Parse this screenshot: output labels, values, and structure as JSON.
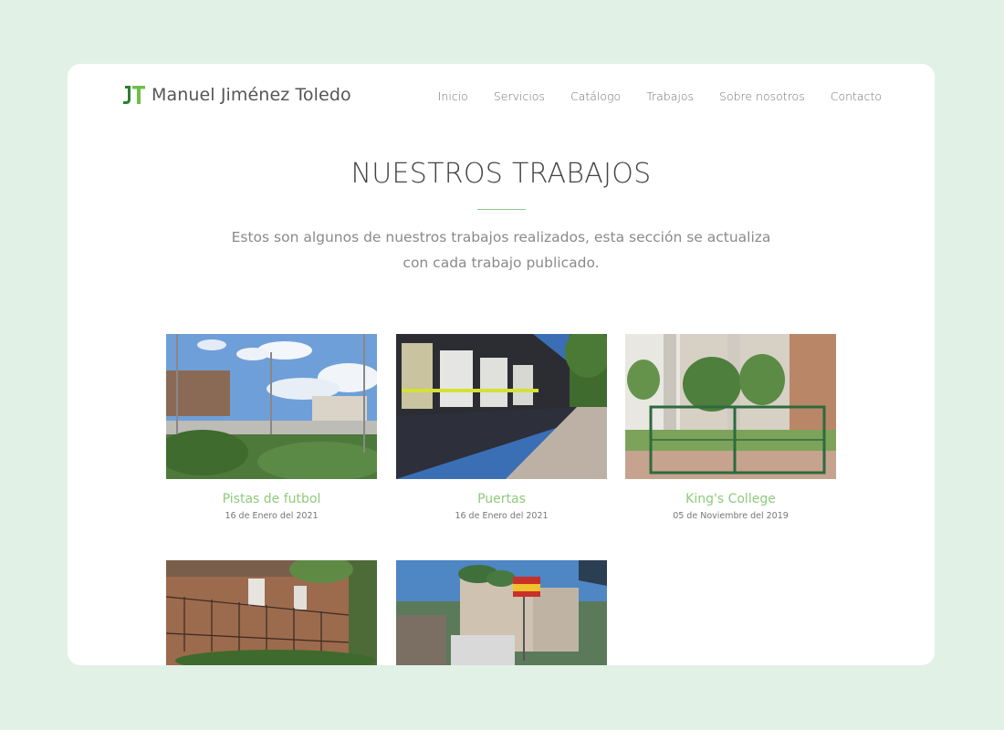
{
  "brand": {
    "name": "Manuel Jiménez Toledo",
    "logo_icon": "jt-logo-icon",
    "colors": {
      "accent": "#8fcb7b",
      "logo_dark": "#2e7d32",
      "logo_light": "#6cc04a"
    }
  },
  "nav": {
    "items": [
      {
        "label": "Inicio"
      },
      {
        "label": "Servicios"
      },
      {
        "label": "Catálogo"
      },
      {
        "label": "Trabajos"
      },
      {
        "label": "Sobre nosotros"
      },
      {
        "label": "Contacto"
      }
    ]
  },
  "hero": {
    "title": "NUESTROS TRABAJOS",
    "subtitle": "Estos son algunos de nuestros trabajos realizados, esta sección se actualiza con cada trabajo publicado."
  },
  "works": [
    {
      "title": "Pistas de futbol",
      "date": "16 de Enero del 2021"
    },
    {
      "title": "Puertas",
      "date": "16 de Enero del 2021"
    },
    {
      "title": "King's College",
      "date": "05 de Noviembre del 2019"
    },
    {
      "title": "",
      "date": ""
    },
    {
      "title": "",
      "date": ""
    }
  ]
}
